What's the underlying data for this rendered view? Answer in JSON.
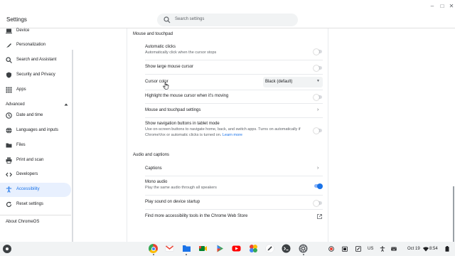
{
  "window": {
    "title": "Settings",
    "search_placeholder": "Search settings",
    "buttons": {
      "minimize": "–",
      "maximize": "□",
      "close": "✕"
    }
  },
  "sidebar": {
    "items": [
      {
        "label": "Device",
        "icon": "laptop-icon"
      },
      {
        "label": "Personalization",
        "icon": "brush-icon"
      },
      {
        "label": "Search and Assistant",
        "icon": "search-icon"
      },
      {
        "label": "Security and Privacy",
        "icon": "shield-icon"
      },
      {
        "label": "Apps",
        "icon": "grid-icon"
      }
    ],
    "advanced_label": "Advanced",
    "advanced_items": [
      {
        "label": "Date and time",
        "icon": "clock-icon"
      },
      {
        "label": "Languages and inputs",
        "icon": "globe-icon"
      },
      {
        "label": "Files",
        "icon": "folder-icon"
      },
      {
        "label": "Print and scan",
        "icon": "printer-icon"
      },
      {
        "label": "Developers",
        "icon": "code-icon"
      },
      {
        "label": "Accessibility",
        "icon": "accessibility-icon"
      },
      {
        "label": "Reset settings",
        "icon": "reset-icon"
      }
    ],
    "about_label": "About ChromeOS"
  },
  "content": {
    "mouse_section_title": "Mouse and touchpad",
    "automatic_clicks": {
      "label": "Automatic clicks",
      "sublabel": "Automatically click when the cursor stops",
      "enabled": false
    },
    "large_cursor": {
      "label": "Show large mouse cursor",
      "enabled": false
    },
    "cursor_color": {
      "label": "Cursor color",
      "value": "Black (default)"
    },
    "highlight_cursor": {
      "label": "Highlight the mouse cursor when it's moving",
      "enabled": false
    },
    "mouse_settings": {
      "label": "Mouse and touchpad settings"
    },
    "nav_buttons": {
      "label": "Show navigation buttons in tablet mode",
      "sublabel_1": "Use on-screen buttons to navigate home, back, and switch apps. Turns on automatically if",
      "sublabel_2": "ChromeVox or automatic clicks is turned on.",
      "link": "Learn more",
      "enabled": false
    },
    "audio_section_title": "Audio and captions",
    "captions": {
      "label": "Captions"
    },
    "mono_audio": {
      "label": "Mono audio",
      "sublabel": "Play the same audio through all speakers",
      "enabled": true
    },
    "startup_sound": {
      "label": "Play sound on device startup",
      "enabled": false
    },
    "web_store": {
      "label": "Find more accessibility tools in the Chrome Web Store"
    }
  },
  "shelf": {
    "apps": [
      "chrome-icon",
      "gmail-icon",
      "files-icon",
      "meet-icon",
      "play-store-icon",
      "youtube-icon",
      "photos-icon",
      "pen-icon",
      "terminal-icon",
      "settings-icon"
    ],
    "tray": {
      "keyboard": "US",
      "date": "Oct 19",
      "time": "8:54"
    }
  },
  "colors": {
    "accent": "#1a73e8",
    "active_bg": "#e8f0fe"
  }
}
